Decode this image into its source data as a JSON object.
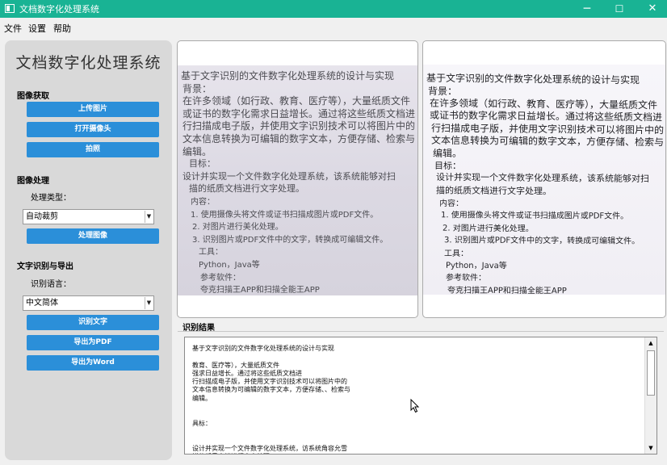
{
  "window": {
    "title": "文档数字化处理系统",
    "icon": "app-window-icon",
    "controls": {
      "minimize": "─",
      "maximize": "☐",
      "close": "✕"
    },
    "accent_color": "#19b394"
  },
  "menu": [
    "文件",
    "设置",
    "帮助"
  ],
  "sidebar": {
    "title": "文档数字化处理系统",
    "image_acquire": {
      "heading": "图像获取",
      "buttons": [
        "上传图片",
        "打开摄像头",
        "拍照"
      ]
    },
    "image_process": {
      "heading": "图像处理",
      "type_label": "处理类型：",
      "type_value": "自动裁剪",
      "button": "处理图像"
    },
    "ocr_export": {
      "heading": "文字识别与导出",
      "lang_label": "识别语言：",
      "lang_value": "中文简体",
      "buttons": [
        "识别文字",
        "导出为PDF",
        "导出为Word"
      ]
    },
    "button_color": "#2b8fd9"
  },
  "document_lines": [
    "基于文字识别的文件数字化处理系统的设计与实现",
    "背景：",
    "在许多领域（如行政、教育、医疗等），大量纸质文件",
    "或证书的数字化需求日益增长。通过将这些纸质文档进",
    "行扫描成电子版，并使用文字识别技术可以将图片中的",
    "文本信息转换为可编辑的数字文本，方便存储、检索与",
    "编辑。",
    "目标：",
    "设计并实现一个文件数字化处理系统，该系统能够对扫",
    "描的纸质文档进行文字处理。",
    "内容：",
    "1. 使用摄像头将文件或证书扫描成图片或PDF文件。",
    "2. 对图片进行美化处理。",
    "3. 识别图片或PDF文件中的文字，转换成可编辑文件。",
    "工具：",
    "Python，Java等",
    "参考软件：",
    "夸克扫描王APP和扫描全能王APP"
  ],
  "result": {
    "label": "识别结果",
    "text": "基于文字识别的文件数字化处理系统的设计与实现\n\n教育、医疗等），大量纸质文件\n强求日益增长。通过将这些纸质文档进\n行扫描成电子版，并使用文字识别技术可以将图片中的\n文本信息转换为可编辑的数字文本，方便存储、、检索与\n编辑。\n\n\n具标：\n\n\n设计并实现一个文件数字化处理系统，访系统角容允雪\n描的纸质文档进行文字处理，\n内容："
  }
}
